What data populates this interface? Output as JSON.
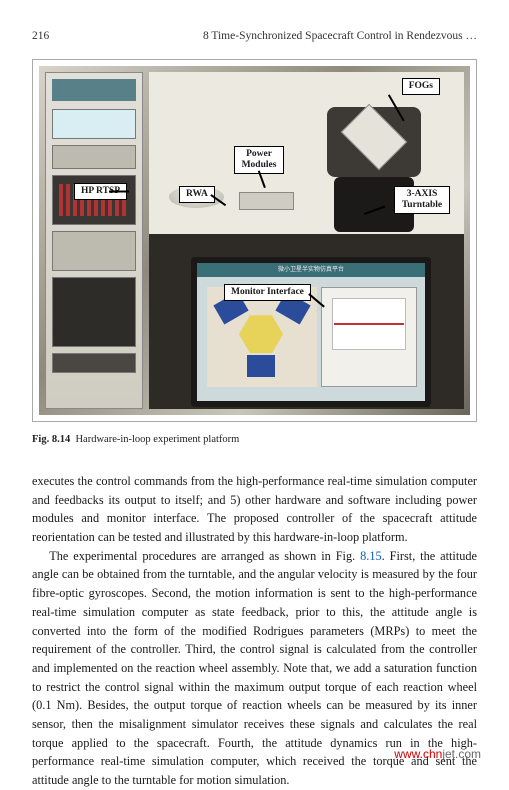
{
  "header": {
    "page_number": "216",
    "running_title": "8   Time-Synchronized Spacecraft Control in Rendezvous …"
  },
  "figure": {
    "callouts": {
      "fogs": "FOGs",
      "power_modules": "Power Modules",
      "turntable": "3-AXIS Turntable",
      "rwa": "RWA",
      "hprtsp": "HP RTSP",
      "monitor": "Monitor Interface"
    },
    "caption_label": "Fig. 8.14",
    "caption_text": "Hardware-in-loop experiment platform"
  },
  "paragraphs": {
    "p1": "executes the control commands from the high-performance real-time simulation computer and feedbacks its output to itself; and 5) other hardware and software including power modules and monitor interface. The proposed controller of the spacecraft attitude reorientation can be tested and illustrated by this hardware-in-loop platform.",
    "p2a": "The experimental procedures are arranged as shown in Fig. ",
    "p2_ref": "8.15",
    "p2b": ". First, the attitude angle can be obtained from the turntable, and the angular velocity is measured by the four fibre-optic gyroscopes. Second, the motion information is sent to the high-performance real-time simulation computer as state feedback, prior to this, the attitude angle is converted into the form of the modified Rodrigues parameters (MRPs) to meet the requirement of the controller. Third, the control signal is calculated from the controller and implemented on the reaction wheel assembly. Note that, we add a saturation function to restrict the control signal within the maximum output torque of each reaction wheel (0.1 Nm). Besides, the output torque of reaction wheels can be measured by its inner sensor, then the misalignment simulator receives these signals and calculates the real torque applied to the spacecraft. Fourth, the attitude dynamics run in the high-performance real-time simulation computer, which received the torque and sent the attitude angle to the turntable for motion simulation."
  },
  "watermark": {
    "a": "www.chn",
    "b": "jet.com"
  }
}
